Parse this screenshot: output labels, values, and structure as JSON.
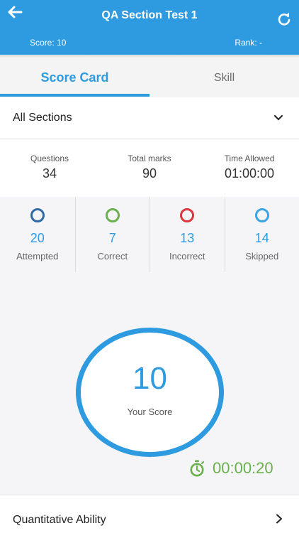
{
  "header": {
    "title": "QA Section Test 1",
    "score_text": "Score: 10",
    "rank_text": "Rank: -",
    "back_icon": "arrow-left-icon",
    "refresh_icon": "refresh-icon",
    "color": "#2e9be0"
  },
  "tabs": [
    {
      "label": "Score Card",
      "active": true
    },
    {
      "label": "Skill",
      "active": false
    }
  ],
  "section_select": {
    "value": "All Sections"
  },
  "stats": [
    {
      "label": "Questions",
      "value": "34"
    },
    {
      "label": "Total marks",
      "value": "90"
    },
    {
      "label": "Time Allowed",
      "value": "01:00:00"
    }
  ],
  "counts": [
    {
      "value": "20",
      "label": "Attempted",
      "ring_color": "#2f6aa6"
    },
    {
      "value": "7",
      "label": "Correct",
      "ring_color": "#6ab04c"
    },
    {
      "value": "13",
      "label": "Incorrect",
      "ring_color": "#d9363e"
    },
    {
      "value": "14",
      "label": "Skipped",
      "ring_color": "#3aa5df"
    }
  ],
  "score": {
    "value": "10",
    "caption": "Your Score"
  },
  "timer": {
    "text": "00:00:20",
    "icon": "stopwatch-icon",
    "color": "#6ab04c"
  },
  "sections": [
    {
      "label": "Quantitative Ability"
    }
  ]
}
